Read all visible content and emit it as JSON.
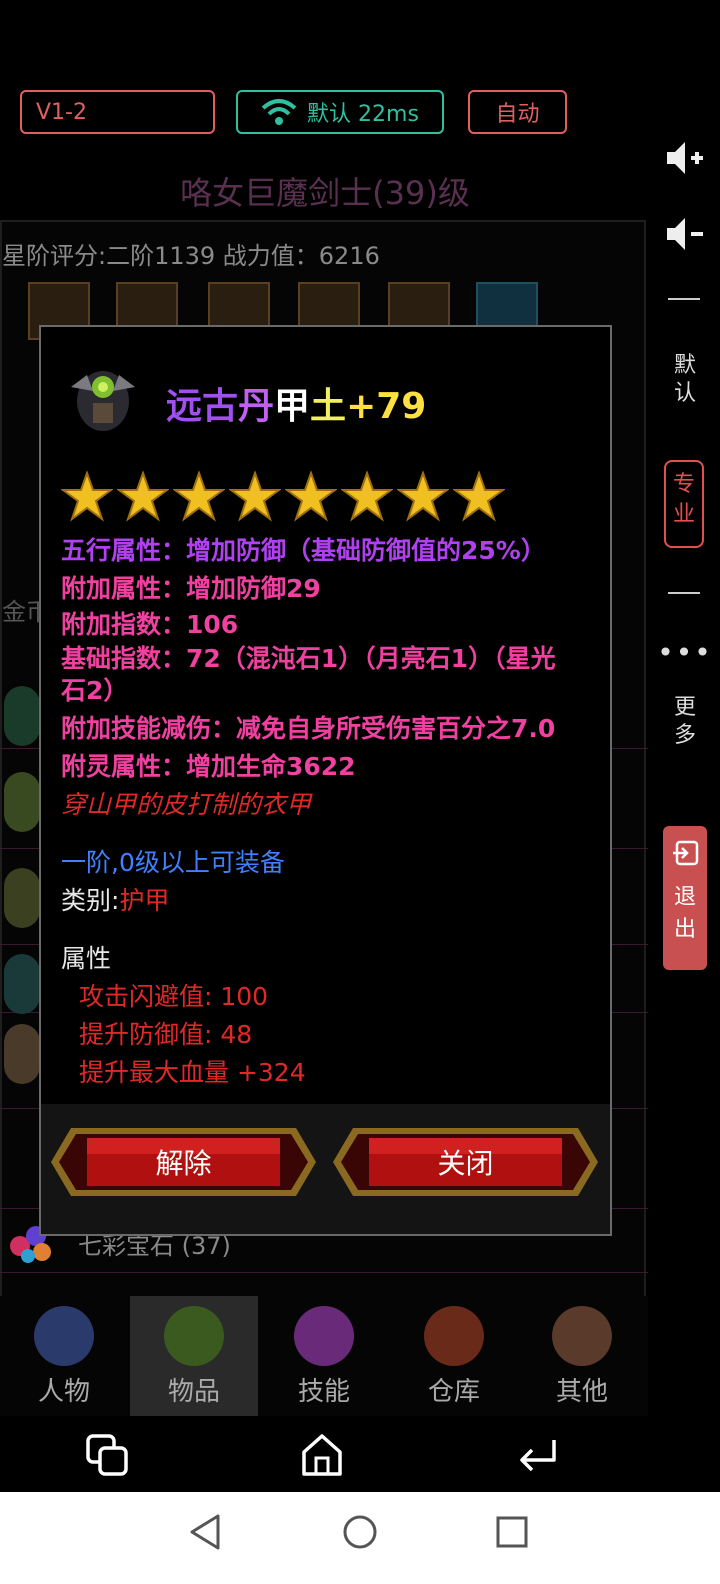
{
  "topbar": {
    "server_label": "V1-2",
    "network_label": "默认 22ms",
    "auto_label": "自动"
  },
  "sidebar": {
    "volume_up_icon": "volume-up-icon",
    "volume_down_icon": "volume-down-icon",
    "default_label": "默\n认",
    "pro_label": "专\n业",
    "more_label": "更\n多",
    "exit_label": "退\n出"
  },
  "character": {
    "title": "咯女巨魔剑士(39)级",
    "score_line": "星阶评分:二阶1139 战力值：6216",
    "gold_fragment": "金币",
    "gem_item": "七彩宝石 (37)"
  },
  "tooltip": {
    "name_parts": [
      "远古",
      "丹",
      "甲",
      "土",
      "+79"
    ],
    "star_count": 8,
    "lines": {
      "wuxing": "五行属性：增加防御（基础防御值的25%）",
      "extra_attr": "附加属性：增加防御29",
      "extra_index": "附加指数：106",
      "base_index_1": "基础指数：72（混沌石1）（月亮石1）（星光",
      "base_index_2": "石2）",
      "skill_reduce": "附加技能减伤：减免自身所受伤害百分之7.0",
      "spirit_attr": "附灵属性：增加生命3622",
      "flavor": "穿山甲的皮打制的衣甲",
      "requirement": "一阶,0级以上可装备",
      "category_label": "类别:",
      "category_value": "护甲",
      "attr_header": "属性",
      "attr_1": "攻击闪避值: 100",
      "attr_2": "提升防御值:  48",
      "attr_3": "提升最大血量 +324"
    },
    "buttons": {
      "remove": "解除",
      "close": "关闭"
    }
  },
  "tabs": [
    {
      "label": "人物"
    },
    {
      "label": "物品"
    },
    {
      "label": "技能"
    },
    {
      "label": "仓库"
    },
    {
      "label": "其他"
    }
  ],
  "colors": {
    "accent_red": "#e06060",
    "accent_teal": "#30c0a0",
    "purple": "#b040f0",
    "pink": "#f040a0",
    "red": "#e02828",
    "blue": "#4080ff"
  }
}
